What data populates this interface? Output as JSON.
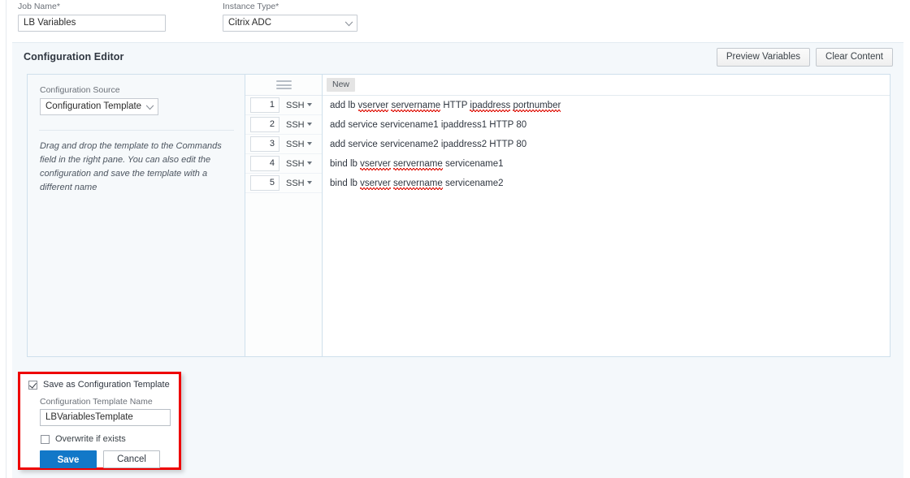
{
  "form": {
    "job_name": {
      "label": "Job Name*",
      "value": "LB Variables",
      "placeholder": ""
    },
    "instance_type": {
      "label": "Instance Type*",
      "value": "Citrix ADC"
    }
  },
  "configuration_editor": {
    "title": "Configuration Editor",
    "preview_variables_label": "Preview Variables",
    "clear_content_label": "Clear Content",
    "left_pane": {
      "source_label": "Configuration Source",
      "source_value": "Configuration Template",
      "hint": "Drag and drop the template to the Commands field in the right pane. You can also edit the configuration and save the template with a different name"
    },
    "mid_pane": {
      "menu_icon": "hamburger-icon",
      "rows": [
        {
          "number": "1",
          "protocol": "SSH"
        },
        {
          "number": "2",
          "protocol": "SSH"
        },
        {
          "number": "3",
          "protocol": "SSH"
        },
        {
          "number": "4",
          "protocol": "SSH"
        },
        {
          "number": "5",
          "protocol": "SSH"
        }
      ]
    },
    "right_pane": {
      "tab_label": "New",
      "commands": [
        "add lb vserver servername HTTP ipaddress portnumber",
        "add service servicename1 ipaddress1 HTTP 80",
        "add service servicename2 ipaddress2 HTTP 80",
        "bind lb vserver servername servicename1",
        "bind lb vserver servername servicename2"
      ]
    }
  },
  "save_template_dialog": {
    "save_as_template_label": "Save as Configuration Template",
    "save_as_template_checked": true,
    "template_name_label": "Configuration Template Name",
    "template_name_value": "LBVariablesTemplate",
    "overwrite_label": "Overwrite if exists",
    "overwrite_checked": false,
    "save_label": "Save",
    "cancel_label": "Cancel",
    "highlight_color": "#ee0000"
  },
  "colors": {
    "panel_bg": "#f4f8fb",
    "primary_button": "#1278c8",
    "spellcheck_underline": "#e2231a",
    "border": "#cfe0ec"
  }
}
